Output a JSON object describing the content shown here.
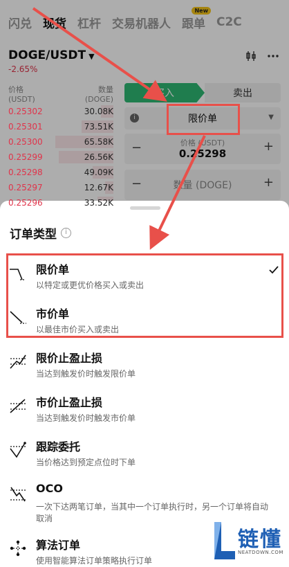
{
  "nav": {
    "items": [
      {
        "label": "闪兑",
        "active": false
      },
      {
        "label": "现货",
        "active": true
      },
      {
        "label": "杠杆",
        "active": false
      },
      {
        "label": "交易机器人",
        "active": false
      },
      {
        "label": "跟单",
        "active": false,
        "badge": "New"
      },
      {
        "label": "C2C",
        "active": false
      }
    ]
  },
  "pair": {
    "name": "DOGE/USDT",
    "change": "-2.65%"
  },
  "orderbook": {
    "header_price": "价格",
    "header_price_unit": "(USDT)",
    "header_qty": "数量",
    "header_qty_unit": "(DOGE)",
    "rows": [
      {
        "price": "0.25302",
        "qty": "30.08K",
        "depth": 0.12
      },
      {
        "price": "0.25301",
        "qty": "73.51K",
        "depth": 0.3
      },
      {
        "price": "0.25300",
        "qty": "65.58K",
        "depth": 0.55
      },
      {
        "price": "0.25299",
        "qty": "26.56K",
        "depth": 0.52
      },
      {
        "price": "0.25298",
        "qty": "49.09K",
        "depth": 0.2
      },
      {
        "price": "0.25297",
        "qty": "12.67K",
        "depth": 0.08
      },
      {
        "price": "0.25296",
        "qty": "33.52K",
        "depth": 0.15
      }
    ]
  },
  "trade": {
    "buy_label": "买入",
    "sell_label": "卖出",
    "order_type": "限价单",
    "price_label": "价格 (USDT)",
    "price_value": "0.25298",
    "amount_label": "数量 (DOGE)"
  },
  "sheet": {
    "title": "订单类型",
    "options": [
      {
        "name": "限价单",
        "desc": "以特定或更优价格买入或卖出",
        "selected": true,
        "icon": "limit-order-icon"
      },
      {
        "name": "市价单",
        "desc": "以最佳市价买入或卖出",
        "selected": false,
        "icon": "market-order-icon"
      },
      {
        "name": "限价止盈止损",
        "desc": "当达到触发价时触发限价单",
        "selected": false,
        "icon": "limit-tpsl-icon"
      },
      {
        "name": "市价止盈止损",
        "desc": "当达到触发价时触发市价单",
        "selected": false,
        "icon": "market-tpsl-icon"
      },
      {
        "name": "跟踪委托",
        "desc": "当价格达到预定点位时下单",
        "selected": false,
        "icon": "trailing-order-icon"
      },
      {
        "name": "OCO",
        "desc": "一次下达两笔订单，当其中一个订单执行时，另一个订单将自动取消",
        "selected": false,
        "icon": "oco-icon"
      },
      {
        "name": "算法订单",
        "desc": "使用智能算法订单策略执行订单",
        "selected": false,
        "icon": "algo-order-icon"
      }
    ]
  },
  "watermark": {
    "text": "链懂",
    "sub": "NEATDOWN.COM"
  },
  "colors": {
    "accent_red": "#e8504a",
    "buy_green": "#2eb874",
    "sell_red": "#e0334a"
  }
}
